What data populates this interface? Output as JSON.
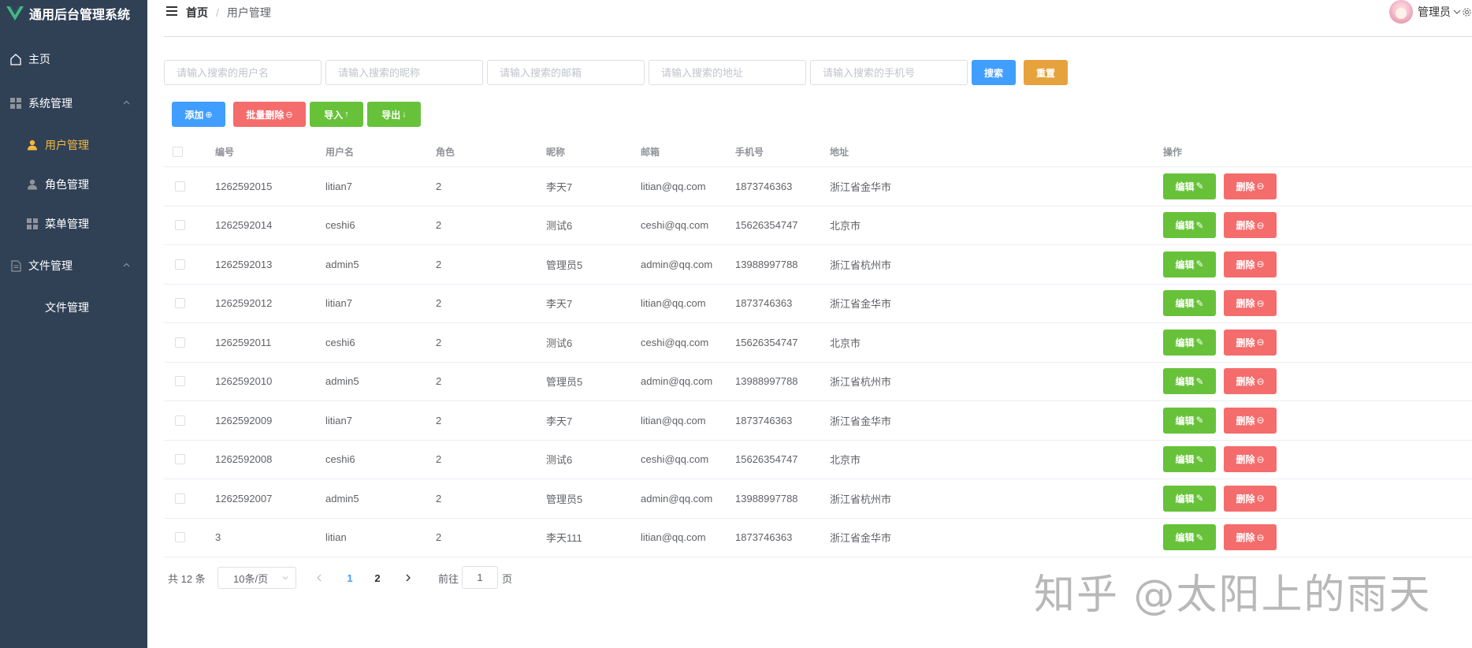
{
  "app": {
    "title": "通用后台管理系统"
  },
  "sidebar": {
    "items": [
      {
        "label": "主页"
      },
      {
        "label": "系统管理"
      },
      {
        "label": "用户管理"
      },
      {
        "label": "角色管理"
      },
      {
        "label": "菜单管理"
      },
      {
        "label": "文件管理"
      },
      {
        "label": "文件管理"
      }
    ]
  },
  "header": {
    "breadcrumb": {
      "home": "首页",
      "separator": "/",
      "current": "用户管理"
    },
    "user_name": "管理员"
  },
  "search": {
    "username_placeholder": "请输入搜索的用户名",
    "nickname_placeholder": "请输入搜索的昵称",
    "email_placeholder": "请输入搜索的邮箱",
    "address_placeholder": "请输入搜索的地址",
    "phone_placeholder": "请输入搜索的手机号",
    "search_label": "搜索",
    "reset_label": "重置"
  },
  "toolbar": {
    "add_label": "添加",
    "batch_delete_label": "批量删除",
    "import_label": "导入",
    "export_label": "导出"
  },
  "table": {
    "columns": [
      "编号",
      "用户名",
      "角色",
      "昵称",
      "邮箱",
      "手机号",
      "地址",
      "操作"
    ],
    "edit_label": "编辑",
    "delete_label": "删除",
    "rows": [
      {
        "id": "1262592015",
        "username": "litian7",
        "role": "2",
        "nickname": "李天7",
        "email": "litian@qq.com",
        "phone": "1873746363",
        "address": "浙江省金华市"
      },
      {
        "id": "1262592014",
        "username": "ceshi6",
        "role": "2",
        "nickname": "测试6",
        "email": "ceshi@qq.com",
        "phone": "15626354747",
        "address": "北京市"
      },
      {
        "id": "1262592013",
        "username": "admin5",
        "role": "2",
        "nickname": "管理员5",
        "email": "admin@qq.com",
        "phone": "13988997788",
        "address": "浙江省杭州市"
      },
      {
        "id": "1262592012",
        "username": "litian7",
        "role": "2",
        "nickname": "李天7",
        "email": "litian@qq.com",
        "phone": "1873746363",
        "address": "浙江省金华市"
      },
      {
        "id": "1262592011",
        "username": "ceshi6",
        "role": "2",
        "nickname": "测试6",
        "email": "ceshi@qq.com",
        "phone": "15626354747",
        "address": "北京市"
      },
      {
        "id": "1262592010",
        "username": "admin5",
        "role": "2",
        "nickname": "管理员5",
        "email": "admin@qq.com",
        "phone": "13988997788",
        "address": "浙江省杭州市"
      },
      {
        "id": "1262592009",
        "username": "litian7",
        "role": "2",
        "nickname": "李天7",
        "email": "litian@qq.com",
        "phone": "1873746363",
        "address": "浙江省金华市"
      },
      {
        "id": "1262592008",
        "username": "ceshi6",
        "role": "2",
        "nickname": "测试6",
        "email": "ceshi@qq.com",
        "phone": "15626354747",
        "address": "北京市"
      },
      {
        "id": "1262592007",
        "username": "admin5",
        "role": "2",
        "nickname": "管理员5",
        "email": "admin@qq.com",
        "phone": "13988997788",
        "address": "浙江省杭州市"
      },
      {
        "id": "3",
        "username": "litian",
        "role": "2",
        "nickname": "李天111",
        "email": "litian@qq.com",
        "phone": "1873746363",
        "address": "浙江省金华市"
      }
    ]
  },
  "pagination": {
    "total_text": "共 12 条",
    "page_size": "10条/页",
    "pages": [
      "1",
      "2"
    ],
    "current_page": "1",
    "goto_label": "前往",
    "goto_value": "1",
    "goto_suffix": "页"
  },
  "watermark": "知乎 @太阳上的雨天",
  "colors": {
    "sidebar_bg": "#304156",
    "active_menu": "#f5b83d",
    "primary": "#409eff",
    "warning": "#e6a23c",
    "danger": "#f56c6c",
    "success": "#67c23a"
  }
}
